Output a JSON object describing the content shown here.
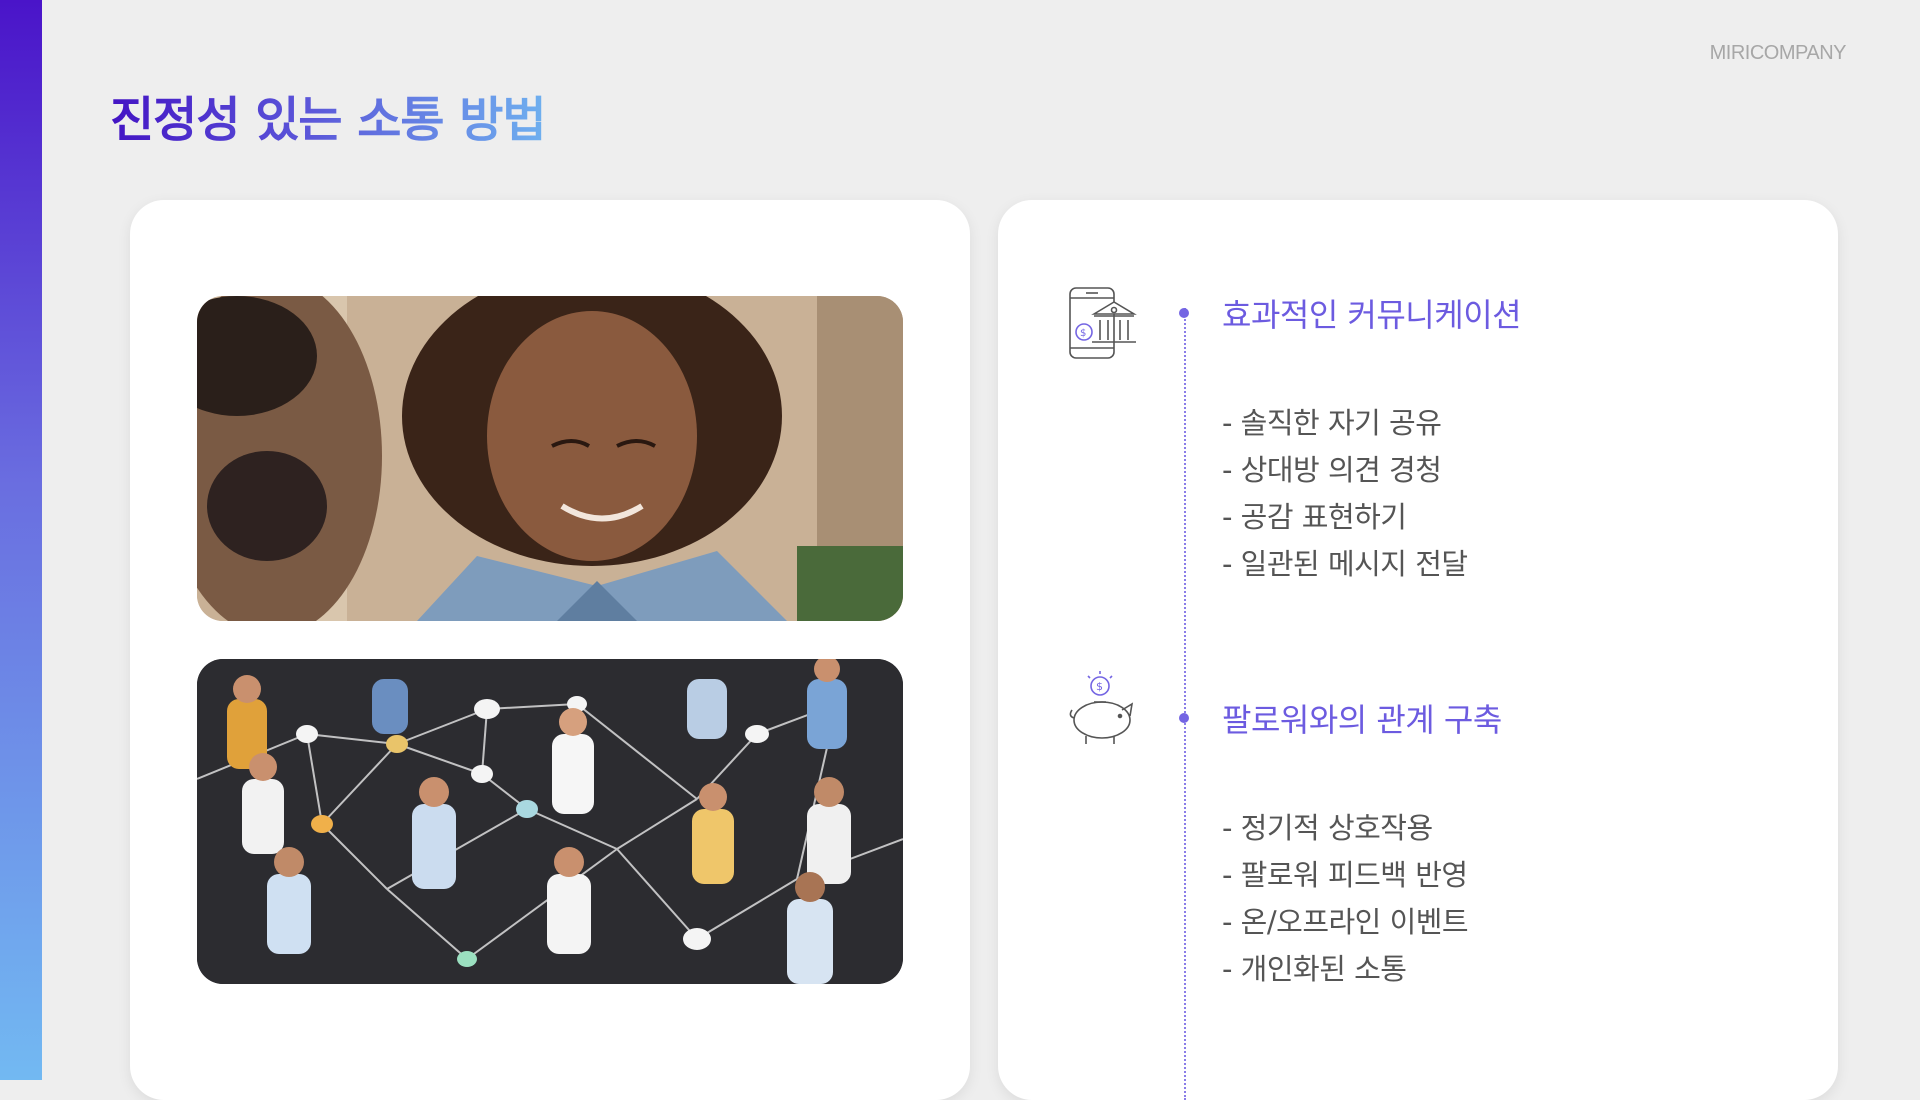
{
  "brand": "MIRICOMPANY",
  "title": "진정성 있는 소통 방법",
  "colors": {
    "accent": "#6c5be0",
    "title_start": "#4314c4",
    "title_end": "#6fb0ef"
  },
  "images": [
    {
      "name": "conversation-photo"
    },
    {
      "name": "people-network-photo"
    }
  ],
  "sections": [
    {
      "icon": "mobile-bank-icon",
      "title": "효과적인 커뮤니케이션",
      "items": [
        "- 솔직한 자기 공유",
        "- 상대방 의견 경청",
        "- 공감 표현하기",
        "- 일관된 메시지 전달"
      ]
    },
    {
      "icon": "piggy-bank-icon",
      "title": "팔로워와의 관계 구축",
      "items": [
        "- 정기적 상호작용",
        "- 팔로워 피드백 반영",
        "- 온/오프라인 이벤트",
        "- 개인화된 소통"
      ]
    }
  ]
}
